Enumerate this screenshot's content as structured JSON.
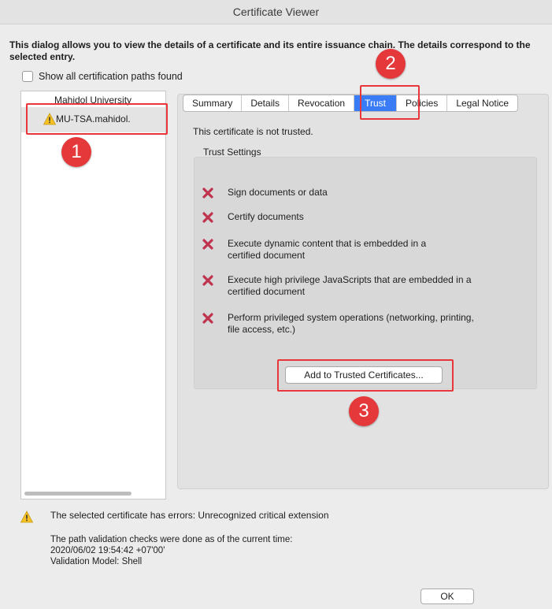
{
  "window": {
    "title": "Certificate Viewer"
  },
  "intro": "This dialog allows you to view the details of a certificate and its entire issuance chain. The details correspond to the selected entry.",
  "show_all_paths": {
    "label": "Show all certification paths found",
    "checked": false
  },
  "tree": {
    "root": "Mahidol University",
    "child": "MU-TSA.mahidol.",
    "child_icon": "warning-icon"
  },
  "tabs": [
    "Summary",
    "Details",
    "Revocation",
    "Trust",
    "Policies",
    "Legal Notice"
  ],
  "active_tab": "Trust",
  "trust": {
    "status": "This certificate is not trusted.",
    "settings_title": "Trust Settings",
    "items": [
      {
        "line1": "Sign documents or data",
        "line2": "",
        "icon": "cross-icon"
      },
      {
        "line1": "Certify documents",
        "line2": "",
        "icon": "cross-icon"
      },
      {
        "line1": "Execute dynamic content that is embedded in a",
        "line2": "certified document",
        "icon": "cross-icon"
      },
      {
        "line1": "Execute high privilege JavaScripts that are embedded in a",
        "line2": "certified document",
        "icon": "cross-icon"
      },
      {
        "line1": "Perform privileged system operations (networking, printing,",
        "line2": "file access, etc.)",
        "icon": "cross-icon"
      }
    ],
    "add_button": "Add to Trusted Certificates..."
  },
  "annotations": [
    "1",
    "2",
    "3"
  ],
  "annotation_color": "#e5383b",
  "error_text": "The selected certificate has errors: Unrecognized critical extension",
  "path_info": {
    "line1": "The path validation checks were done as of the current time:",
    "line2": "2020/06/02 19:54:42 +07'00'",
    "line3": "Validation Model: Shell"
  },
  "ok_button": "OK",
  "accent_color": "#3a7cf5"
}
